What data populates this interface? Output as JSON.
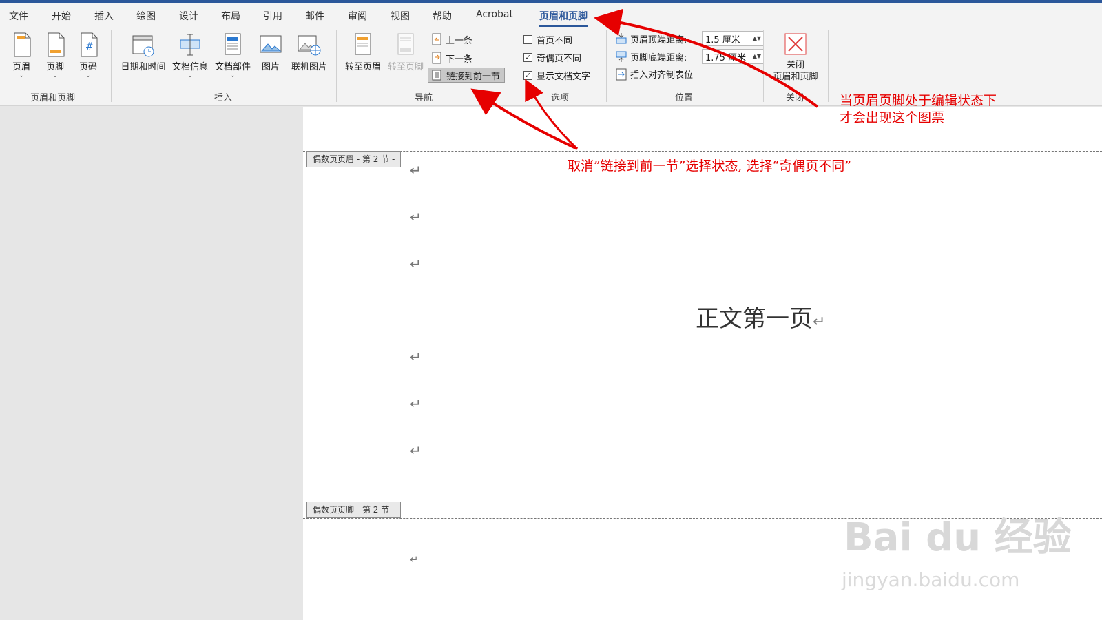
{
  "menubar": {
    "tabs": [
      "文件",
      "开始",
      "插入",
      "绘图",
      "设计",
      "布局",
      "引用",
      "邮件",
      "审阅",
      "视图",
      "帮助",
      "Acrobat",
      "页眉和页脚"
    ]
  },
  "ribbon": {
    "groups": {
      "header_footer": {
        "label": "页眉和页脚",
        "buttons": [
          "页眉",
          "页脚",
          "页码"
        ]
      },
      "insert": {
        "label": "插入",
        "buttons": [
          "日期和时间",
          "文档信息",
          "文档部件",
          "图片",
          "联机图片"
        ]
      },
      "navigation": {
        "label": "导航",
        "goto_header": "转至页眉",
        "goto_footer": "转至页脚",
        "previous": "上一条",
        "next": "下一条",
        "link_previous": "链接到前一节"
      },
      "options": {
        "label": "选项",
        "first_page": "首页不同",
        "odd_even": "奇偶页不同",
        "show_text": "显示文档文字",
        "first_page_checked": false,
        "odd_even_checked": true,
        "show_text_checked": true
      },
      "position": {
        "label": "位置",
        "header_label": "页眉顶端距离:",
        "header_value": "1.5 厘米",
        "footer_label": "页脚底端距离:",
        "footer_value": "1.75 厘米",
        "align_tab": "插入对齐制表位"
      },
      "close": {
        "label": "关闭",
        "button": "关闭\n页眉和页脚"
      }
    }
  },
  "document": {
    "header_tab": "偶数页页眉 - 第 2 节 -",
    "footer_tab": "偶数页页脚 - 第 2 节 -",
    "body_text": "正文第一页",
    "paragraph_mark": "↵"
  },
  "annotations": {
    "note_right_line1": "当页眉页脚处于编辑状态下",
    "note_right_line2": "才会出现这个图票",
    "note_center": "取消”链接到前一节”选择状态, 选择“奇偶页不同”"
  },
  "watermark": {
    "main": "Bai du 经验",
    "sub": "jingyan.baidu.com"
  },
  "colors": {
    "accent": "#2b579a",
    "annotation": "#e60000"
  }
}
